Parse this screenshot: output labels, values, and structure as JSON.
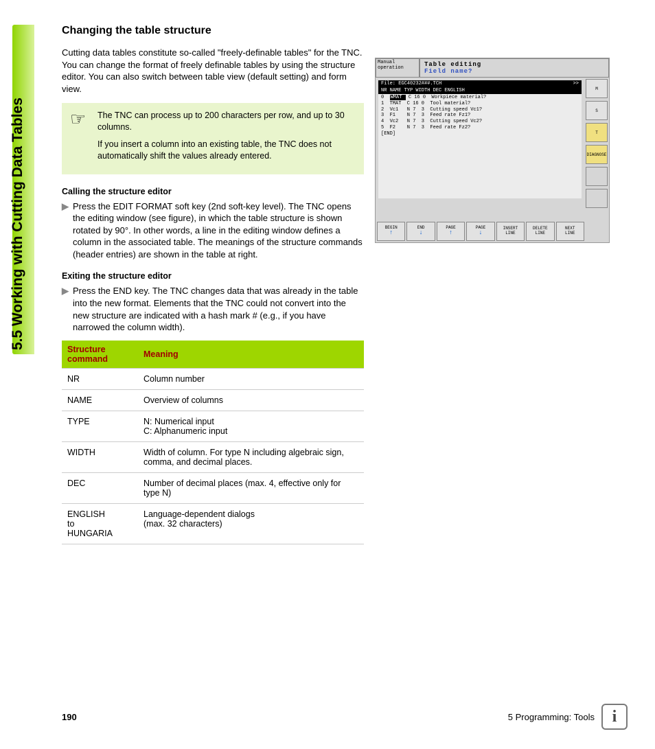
{
  "sidebar": {
    "section_label": "5.5 Working with Cutting Data Tables"
  },
  "heading": "Changing the table structure",
  "intro": "Cutting data tables constitute so-called \"freely-definable tables\" for the TNC. You can change the format of freely definable tables by using the structure editor. You can also switch between table view (default setting) and form view.",
  "note": {
    "icon": "☞",
    "line1": "The TNC can process up to 200 characters per row, and up to 30 columns.",
    "line2": "If you insert a column into an existing table, the TNC does not automatically shift the values already entered."
  },
  "sections": [
    {
      "title": "Calling the structure editor",
      "body": "Press the EDIT FORMAT soft key (2nd soft-key level). The TNC opens the editing window (see figure), in which the table structure is shown rotated by 90°. In other words, a line in the editing window defines a column in the associated table. The meanings of the structure commands (header entries) are shown in the table at right."
    },
    {
      "title": "Exiting the structure editor",
      "body": "Press the END key. The TNC changes data that was already in the table into the new format. Elements that the TNC could not convert into the new structure are indicated with a hash mark # (e.g., if you have narrowed the column width)."
    }
  ],
  "table": {
    "head": {
      "c1": "Structure command",
      "c2": "Meaning"
    },
    "rows": [
      {
        "c1": "NR",
        "c2": "Column number"
      },
      {
        "c1": "NAME",
        "c2": "Overview of columns"
      },
      {
        "c1": "TYPE",
        "c2": "N: Numerical input\nC: Alphanumeric input"
      },
      {
        "c1": "WIDTH",
        "c2": "Width of column. For type N including algebraic sign, comma, and decimal places."
      },
      {
        "c1": "DEC",
        "c2": "Number of decimal places (max. 4, effective only for type N)"
      },
      {
        "c1": "ENGLISH\nto\nHUNGARIA",
        "c2": "Language-dependent dialogs\n(max. 32 characters)"
      }
    ]
  },
  "screenshot": {
    "mode": "Manual operation",
    "title": "Table editing",
    "subtitle": "Field name?",
    "file_label": "File: EGC40232###.TCH",
    "file_right": ">>",
    "col_head": "NR  NAME   TYP WIDTH DEC ENGLISH",
    "rows": [
      {
        "nr": "0",
        "name": "WMAT",
        "typ": "C",
        "width": "16",
        "dec": "0",
        "eng": "Workpiece material?"
      },
      {
        "nr": "1",
        "name": "TMAT",
        "typ": "C",
        "width": "16",
        "dec": "0",
        "eng": "Tool material?"
      },
      {
        "nr": "2",
        "name": "Vc1",
        "typ": "N",
        "width": "7",
        "dec": "3",
        "eng": "Cutting speed Vc1?"
      },
      {
        "nr": "3",
        "name": "F1",
        "typ": "N",
        "width": "7",
        "dec": "3",
        "eng": "Feed rate Fz1?"
      },
      {
        "nr": "4",
        "name": "Vc2",
        "typ": "N",
        "width": "7",
        "dec": "3",
        "eng": "Cutting speed Vc2?"
      },
      {
        "nr": "5",
        "name": "F2",
        "typ": "N",
        "width": "7",
        "dec": "3",
        "eng": "Feed rate Fz2?"
      }
    ],
    "end": "[END]",
    "sidebtns": [
      "M",
      "S",
      "T",
      "DIAGNOSE",
      "",
      ""
    ],
    "softkeys": [
      "BEGIN",
      "END",
      "PAGE",
      "PAGE",
      "INSERT LINE",
      "DELETE LINE",
      "NEXT LINE"
    ]
  },
  "footer": {
    "page": "190",
    "chapter": "5 Programming: Tools",
    "info_icon": "i"
  }
}
